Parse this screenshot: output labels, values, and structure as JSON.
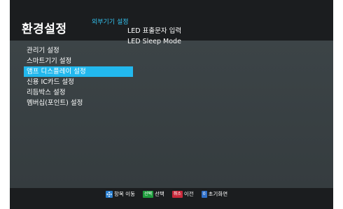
{
  "header": {
    "title": "환경설정",
    "subtitle": "외부기기 설정"
  },
  "menu": {
    "items": [
      {
        "label": "관리기 설정"
      },
      {
        "label": "스마트기기 설정"
      },
      {
        "label": "앰프 디스플레이 설정",
        "selected": true
      },
      {
        "label": "신용 IC카드 설정"
      },
      {
        "label": "리듬박스 설정"
      },
      {
        "label": "멤버십(포인트) 설정"
      }
    ]
  },
  "submenu": {
    "items": [
      {
        "label": "LED 표출문자 입력"
      },
      {
        "label": "LED Sleep Mode"
      }
    ]
  },
  "footer": {
    "hints": [
      {
        "key": "",
        "key_icon": "dpad-icon",
        "label": "항목 이동"
      },
      {
        "key": "선택",
        "key_color": "#1e9c3c",
        "label": "선택"
      },
      {
        "key": "취소",
        "key_color": "#c8283a",
        "label": "이전"
      },
      {
        "key": "0",
        "key_color": "#2f6fc8",
        "label": "초기화면"
      }
    ]
  },
  "colors": {
    "accent": "#22b8ee",
    "subtitle": "#33c3f0",
    "background": "#1b1d1f",
    "panel": "#3c4447"
  }
}
